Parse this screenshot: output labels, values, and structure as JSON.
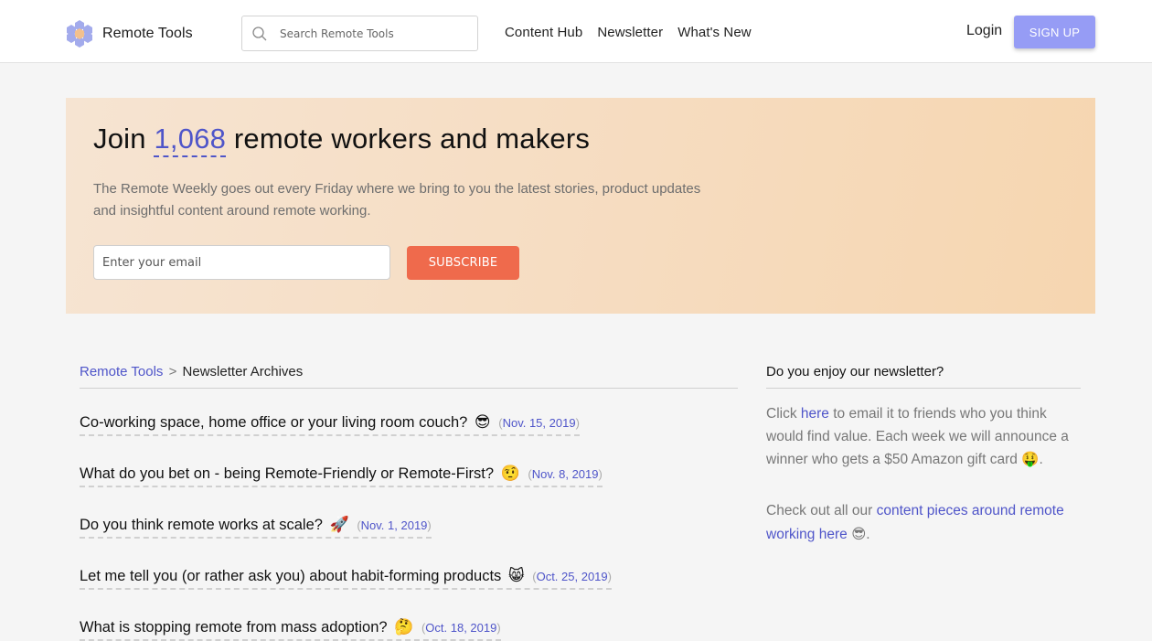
{
  "header": {
    "logo_text": "Remote Tools",
    "logo_icon": "hexagon-flower-logo",
    "search": {
      "placeholder": "Search Remote Tools",
      "value": "",
      "icon": "search-icon"
    },
    "nav": [
      {
        "label": "Content Hub"
      },
      {
        "label": "Newsletter"
      },
      {
        "label": "What's New"
      }
    ],
    "login_label": "Login",
    "signup_label": "SIGN UP"
  },
  "hero": {
    "title_prefix": "Join ",
    "subscriber_count": "1,068",
    "title_suffix": " remote workers and makers",
    "description": "The Remote Weekly goes out every Friday where we bring to you the latest stories, product updates and insightful content around remote working.",
    "email_placeholder": "Enter your email",
    "email_value": "",
    "subscribe_label": "SUBSCRIBE"
  },
  "breadcrumb": {
    "root": "Remote Tools",
    "separator": ">",
    "current": "Newsletter Archives"
  },
  "issues": [
    {
      "title": "Co-working space, home office or your living room couch?",
      "emoji": "😎",
      "emoji_name": "sunglasses-face-icon",
      "date": "Nov. 15, 2019"
    },
    {
      "title": "What do you bet on - being Remote-Friendly or Remote-First?",
      "emoji": "🤨",
      "emoji_name": "raised-eyebrow-face-icon",
      "date": "Nov. 8, 2019"
    },
    {
      "title": "Do you think remote works at scale?",
      "emoji": "🚀",
      "emoji_name": "rocket-icon",
      "date": "Nov. 1, 2019"
    },
    {
      "title": "Let me tell you (or rather ask you) about habit-forming products",
      "emoji": "😸",
      "emoji_name": "grinning-cat-icon",
      "date": "Oct. 25, 2019"
    },
    {
      "title": "What is stopping remote from mass adoption?",
      "emoji": "🤔",
      "emoji_name": "thinking-face-icon",
      "date": "Oct. 18, 2019"
    }
  ],
  "sidebar": {
    "title": "Do you enjoy our newsletter?",
    "para1": {
      "before": "Click ",
      "link": "here",
      "after": " to email it to friends who you think would find value. Each week we will announce a winner who gets a $50 Amazon gift card ",
      "emoji": "🤑",
      "end": "."
    },
    "para2": {
      "before": "Check out all our ",
      "link": "content pieces around remote working here",
      "emoji": "😎",
      "end": "."
    }
  },
  "colors": {
    "accent": "#4f55c9",
    "signup": "#969cf5",
    "subscribe": "#ef6a4c",
    "hero_bg": "#f6dcc0",
    "page_bg": "#f5f5f5"
  }
}
